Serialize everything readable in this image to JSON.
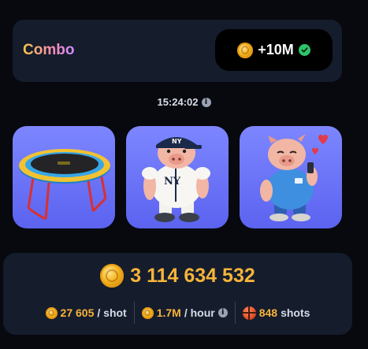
{
  "combo": {
    "title": "Combo",
    "reward": "+10M"
  },
  "timer": {
    "value": "15:24:02"
  },
  "cards": [
    {
      "name": "trampoline",
      "icon": "trampoline-icon"
    },
    {
      "name": "baseball-pig",
      "icon": "pig-baseball-icon"
    },
    {
      "name": "pig-in-love",
      "icon": "pig-hearts-icon"
    }
  ],
  "balance": {
    "value": "3 114 634 532"
  },
  "stats": {
    "per_shot_value": "27 605",
    "per_shot_unit": "/ shot",
    "per_hour_value": "1.7M",
    "per_hour_unit": "/ hour",
    "shots_value": "848",
    "shots_unit": "shots"
  },
  "colors": {
    "accent_gold": "#f6b43a",
    "card_bg": "#151c2c",
    "tile_purple": "#6c74f8",
    "check_green": "#2fc46b"
  }
}
